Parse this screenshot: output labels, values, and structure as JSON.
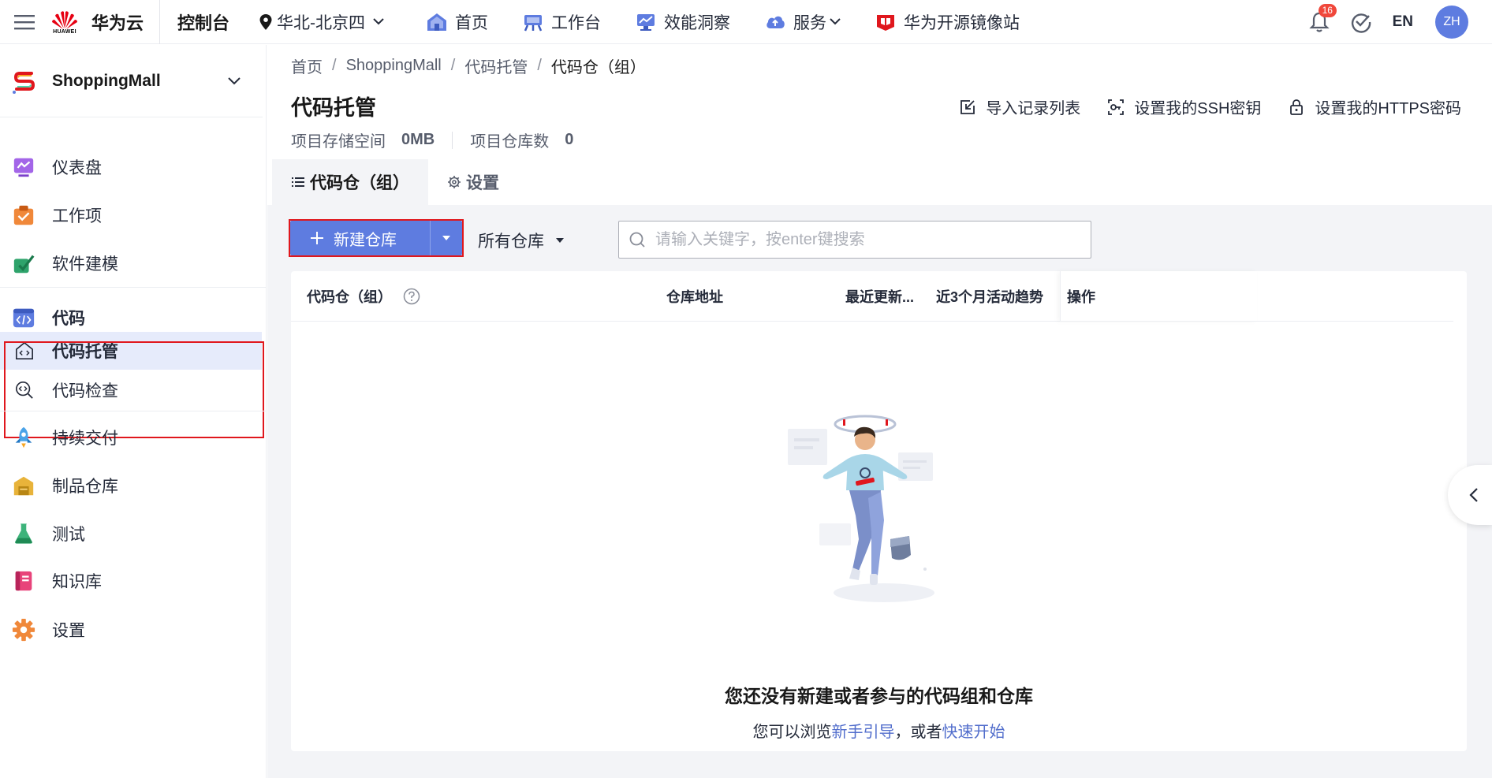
{
  "topbar": {
    "brand_name": "华为云",
    "brand_sub": "HUAWEI",
    "console": "控制台",
    "region": "华北-北京四",
    "nav": [
      {
        "label": "首页",
        "icon": "home-icon"
      },
      {
        "label": "工作台",
        "icon": "workbench-icon"
      },
      {
        "label": "效能洞察",
        "icon": "insight-icon"
      },
      {
        "label": "服务",
        "icon": "service-icon"
      },
      {
        "label": "华为开源镜像站",
        "icon": "mirror-icon"
      }
    ],
    "notification_count": "16",
    "lang": "EN",
    "avatar": "ZH"
  },
  "sidebar": {
    "project": "ShoppingMall",
    "items": [
      {
        "label": "仪表盘",
        "icon": "dashboard-icon"
      },
      {
        "label": "工作项",
        "icon": "work-item-icon"
      },
      {
        "label": "软件建模",
        "icon": "modeling-icon"
      },
      {
        "label": "代码",
        "icon": "code-icon"
      },
      {
        "label": "代码托管",
        "icon": "code-hosting-icon"
      },
      {
        "label": "代码检查",
        "icon": "code-check-icon"
      },
      {
        "label": "持续交付",
        "icon": "delivery-icon"
      },
      {
        "label": "制品仓库",
        "icon": "artifact-icon"
      },
      {
        "label": "测试",
        "icon": "test-icon"
      },
      {
        "label": "知识库",
        "icon": "wiki-icon"
      },
      {
        "label": "设置",
        "icon": "settings-icon"
      }
    ]
  },
  "breadcrumb": [
    "首页",
    "ShoppingMall",
    "代码托管",
    "代码仓（组）"
  ],
  "page": {
    "title": "代码托管",
    "actions": [
      "导入记录列表",
      "设置我的SSH密钥",
      "设置我的HTTPS密码"
    ],
    "storage_label": "项目存储空间",
    "storage_value": "0MB",
    "repo_count_label": "项目仓库数",
    "repo_count_value": "0",
    "tabs": [
      "代码仓（组）",
      "设置"
    ]
  },
  "toolbar": {
    "new_repo": "新建仓库",
    "filter": "所有仓库",
    "search_placeholder": "请输入关键字，按enter键搜索"
  },
  "table": {
    "columns": [
      "代码仓（组）",
      "仓库地址",
      "最近更新...",
      "近3个月活动趋势",
      "操作"
    ]
  },
  "empty": {
    "title": "您还没有新建或者参与的代码组和仓库",
    "sub_prefix": "您可以浏览",
    "link1": "新手引导",
    "sub_middle": "，或者",
    "link2": "快速开始"
  },
  "colors": {
    "primary": "#5e7ce0",
    "highlight_box": "#e0171d",
    "active_menu_bg": "#e6ebfb",
    "link": "#526ecc"
  }
}
